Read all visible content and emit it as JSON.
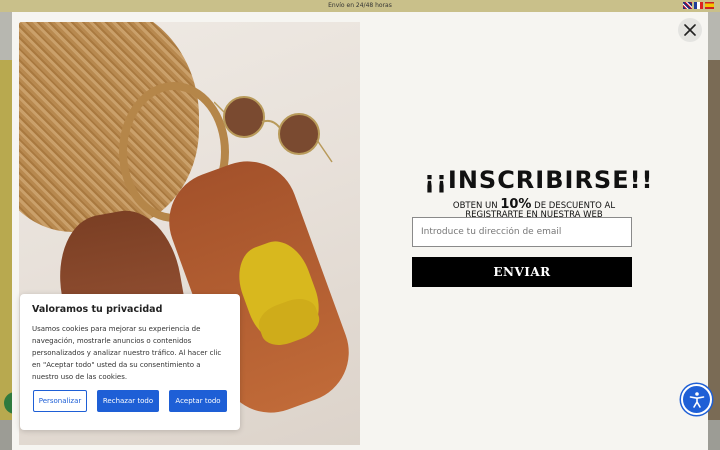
{
  "topbar": {
    "shipping_text": "Envío en 24/48 horas"
  },
  "colors": {
    "accent": "#1e5fd6",
    "submit_bg": "#000000",
    "modal_bg": "#f6f5f1"
  },
  "modal": {
    "close_icon": "close-icon",
    "title": "¡¡INSCRIBIRSE!!",
    "subtitle_prefix": "OBTEN UN",
    "subtitle_highlight": "10%",
    "subtitle_suffix": "DE DESCUENTO AL REGISTRARTE EN NUESTRA WEB",
    "email_placeholder": "Introduce tu dirección de email",
    "submit_label": "ENVIAR"
  },
  "cookie_banner": {
    "title": "Valoramos tu privacidad",
    "body": "Usamos cookies para mejorar su experiencia de navegación, mostrarle anuncios o contenidos personalizados y analizar nuestro tráfico. Al hacer clic en \"Aceptar todo\" usted da su consentimiento a nuestro uso de las cookies.",
    "customize_label": "Personalizar",
    "reject_label": "Rechazar todo",
    "accept_label": "Aceptar todo"
  },
  "accessibility": {
    "icon": "accessibility-icon"
  }
}
